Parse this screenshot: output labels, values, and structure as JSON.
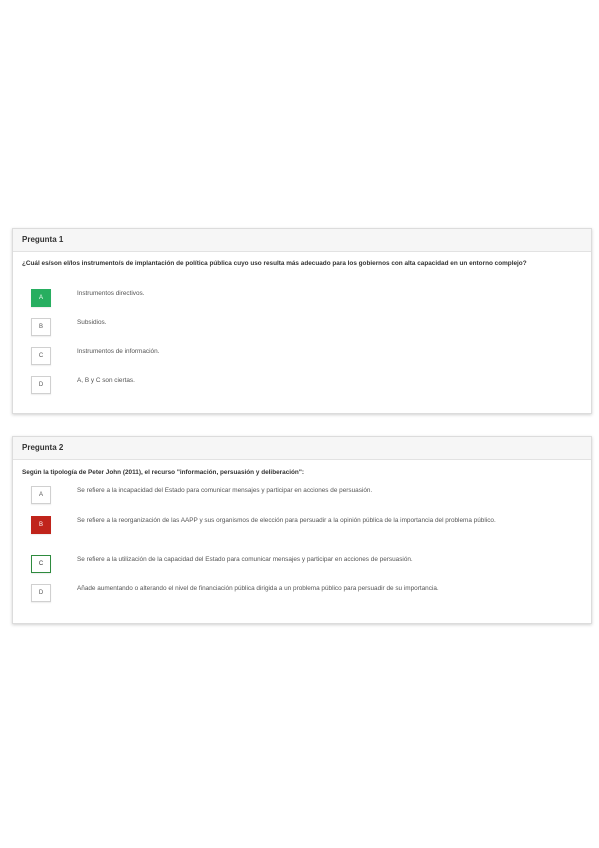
{
  "questions": [
    {
      "header": "Pregunta 1",
      "text": "¿Cuál es/son el/los instrumento/s de implantación de política pública cuyo uso resulta más adecuado para los gobiernos con alta capacidad en un entorno complejo?",
      "options": [
        {
          "letter": "A",
          "text": "Instrumentos directivos.",
          "state": "correct"
        },
        {
          "letter": "B",
          "text": "Subsidios.",
          "state": "none"
        },
        {
          "letter": "C",
          "text": "Instrumentos de información.",
          "state": "none"
        },
        {
          "letter": "D",
          "text": "A, B y C son ciertas.",
          "state": "none"
        }
      ]
    },
    {
      "header": "Pregunta 2",
      "text": "Según la tipología de Peter John (2011), el recurso \"información, persuasión y deliberación\":",
      "options": [
        {
          "letter": "A",
          "text": "Se refiere a la incapacidad del Estado para comunicar mensajes y participar en acciones de persuasión.",
          "state": "none"
        },
        {
          "letter": "B",
          "text": "Se refiere a la reorganización de las AAPP y sus organismos de elección para persuadir a la opinión pública de la importancia del problema público.",
          "state": "wrong"
        },
        {
          "letter": "C",
          "text": "Se refiere a la utilización de la capacidad del Estado para comunicar mensajes y participar en acciones de persuasión.",
          "state": "expected"
        },
        {
          "letter": "D",
          "text": "Añade aumentando o alterando el nivel de financiación pública dirigida a un problema público para persuadir de su importancia.",
          "state": "none"
        }
      ]
    }
  ],
  "colors": {
    "correct": "#27ae60",
    "wrong": "#c0241b",
    "expected_border": "#2e8b3e"
  }
}
